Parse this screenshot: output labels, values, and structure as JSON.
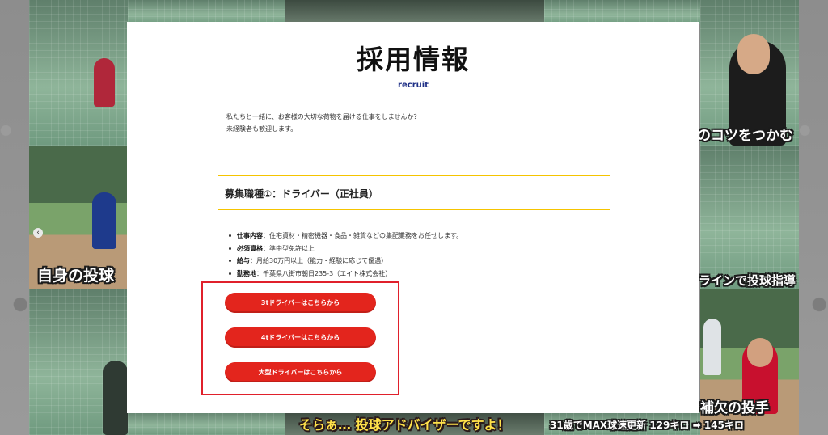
{
  "page": {
    "title": "採用情報",
    "subtitle": "recruit",
    "intro_lines": [
      "私たちと一緒に、お客様の大切な荷物を届ける仕事をしませんか？",
      "未経験者も歓迎します。"
    ]
  },
  "job": {
    "heading": "募集職種①：ドライバー（正社員）",
    "details": [
      {
        "label": "仕事内容",
        "value": "：住宅資材・精密機器・食品・雑貨などの集配業務をお任せします。"
      },
      {
        "label": "必須資格",
        "value": "：準中型免許以上"
      },
      {
        "label": "給与",
        "value": "：月給30万円以上（能力・経験に応じて優遇）"
      },
      {
        "label": "勤務地",
        "value": "：千葉県八街市朝日235-3（エイト株式会社）"
      }
    ],
    "buttons": [
      {
        "label": "3tドライバーはこちらから"
      },
      {
        "label": "4tドライバーはこちらから"
      },
      {
        "label": "大型ドライバーはこちらから"
      }
    ]
  },
  "background": {
    "captions": [
      "自身の投球",
      "のコツをつかむ",
      "ラインで投球指導",
      "そらぁ… 投球アドバイザーですよ！",
      "補欠の投手",
      "31歳でMAX球速更新 129キロ ➡ 145キロ"
    ],
    "carousel_arrow": "‹"
  },
  "colors": {
    "accent_yellow": "#f5c400",
    "button_red": "#e3251d",
    "highlight_red": "#e0202b",
    "subtitle_navy": "#1e2f86"
  }
}
